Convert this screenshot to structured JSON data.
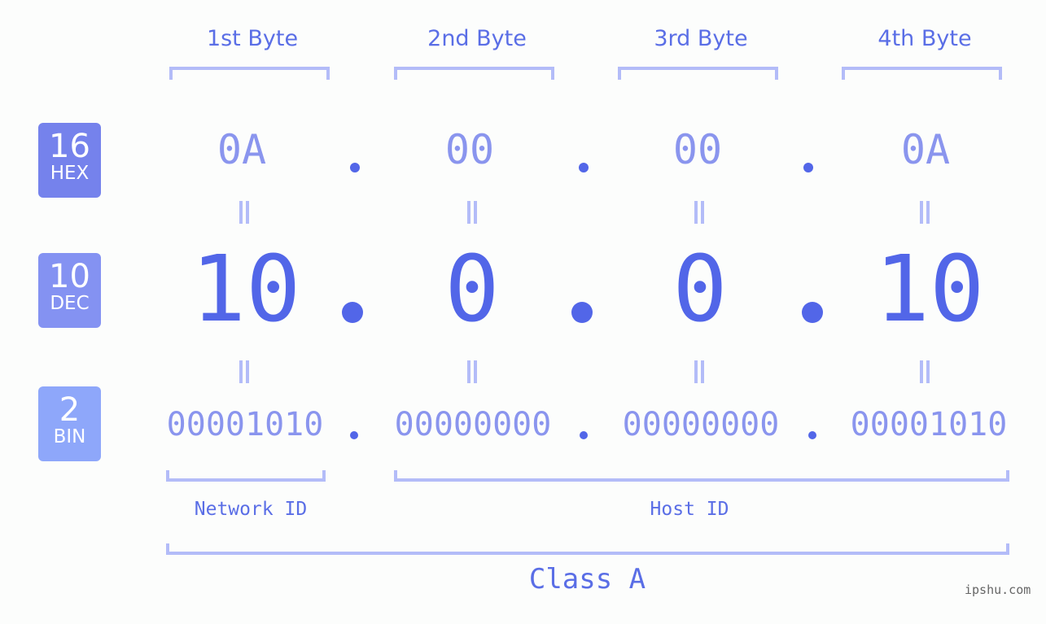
{
  "bytes": [
    {
      "label": "1st Byte",
      "hex": "0A",
      "dec": "10",
      "bin": "00001010"
    },
    {
      "label": "2nd Byte",
      "hex": "00",
      "dec": "0",
      "bin": "00000000"
    },
    {
      "label": "3rd Byte",
      "hex": "00",
      "dec": "0",
      "bin": "00000000"
    },
    {
      "label": "4th Byte",
      "hex": "0A",
      "dec": "10",
      "bin": "00001010"
    }
  ],
  "badges": {
    "hex": {
      "num": "16",
      "label": "HEX",
      "color": "#7582ec"
    },
    "dec": {
      "num": "10",
      "label": "DEC",
      "color": "#8492f2"
    },
    "bin": {
      "num": "2",
      "label": "BIN",
      "color": "#8ea7fa"
    }
  },
  "segments": {
    "network": "Network ID",
    "host": "Host ID",
    "class": "Class A"
  },
  "watermark": "ipshu.com",
  "colors": {
    "accent": "#5266e8",
    "light": "#8a95ee",
    "bracket": "#b3bcf8"
  }
}
